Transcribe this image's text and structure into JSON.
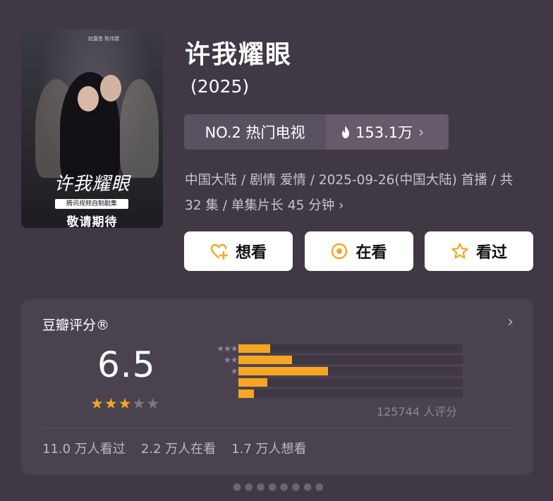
{
  "poster": {
    "title": "许我耀眼",
    "sub": "腾讯视频自制剧集",
    "tagline": "敬请期待",
    "credits": "赵露思   陈伟霆"
  },
  "header": {
    "title": "许我耀眼",
    "year": "(2025)"
  },
  "rank": {
    "label": "NO.2 热门电视",
    "heat": "153.1万",
    "chevron": "›"
  },
  "meta": {
    "text": "中国大陆 / 剧情 爱情 / 2025-09-26(中国大陆) 首播 / 共 32 集 / 单集片长 45 分钟",
    "chevron": "›"
  },
  "actions": [
    {
      "label": "想看",
      "icon": "heart-plus-icon"
    },
    {
      "label": "在看",
      "icon": "target-icon"
    },
    {
      "label": "看过",
      "icon": "star-outline-icon"
    }
  ],
  "rating": {
    "title": "豆瓣评分®",
    "chevron": "›",
    "score": "6.5",
    "stars_filled": 3,
    "stars_total": 5,
    "distribution": [
      {
        "stars": "★★★★★",
        "fraction": 0.14
      },
      {
        "stars": "★★★★",
        "fraction": 0.24
      },
      {
        "stars": "★★★",
        "fraction": 0.4
      },
      {
        "stars": "★★",
        "fraction": 0.13
      },
      {
        "stars": "★",
        "fraction": 0.07
      }
    ],
    "count": "125744 人评分",
    "stats": [
      "11.0 万人看过",
      "2.2 万人在看",
      "1.7 万人想看"
    ]
  },
  "colors": {
    "background": "#413845",
    "card": "#4b4250",
    "accent": "#f5a623"
  }
}
